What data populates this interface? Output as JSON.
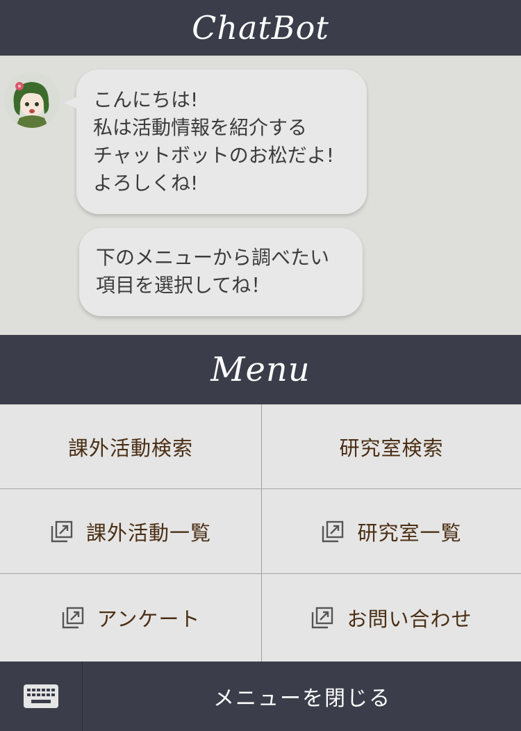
{
  "header": {
    "title": "ChatBot"
  },
  "chat": {
    "messages": [
      {
        "lines": [
          "こんにちは!",
          "私は活動情報を紹介する",
          "チャットボットのお松だよ!",
          "よろしくね!"
        ]
      },
      {
        "lines": [
          "下のメニューから調べたい",
          "項目を選択してね！"
        ]
      }
    ]
  },
  "menu": {
    "title": "Menu",
    "items": [
      {
        "label": "課外活動検索",
        "icon": ""
      },
      {
        "label": "研究室検索",
        "icon": ""
      },
      {
        "label": "課外活動一覧",
        "icon": "external-link-icon"
      },
      {
        "label": "研究室一覧",
        "icon": "external-link-icon"
      },
      {
        "label": "アンケート",
        "icon": "external-link-icon"
      },
      {
        "label": "お問い合わせ",
        "icon": "external-link-icon"
      }
    ]
  },
  "footer": {
    "keyboard_icon": "keyboard-icon",
    "close_label": "メニューを閉じる"
  },
  "colors": {
    "header_bg": "#3b3e4a",
    "chat_bg": "#dededa",
    "bubble_bg": "#e8e8e8",
    "menu_text": "#4a2e14"
  }
}
